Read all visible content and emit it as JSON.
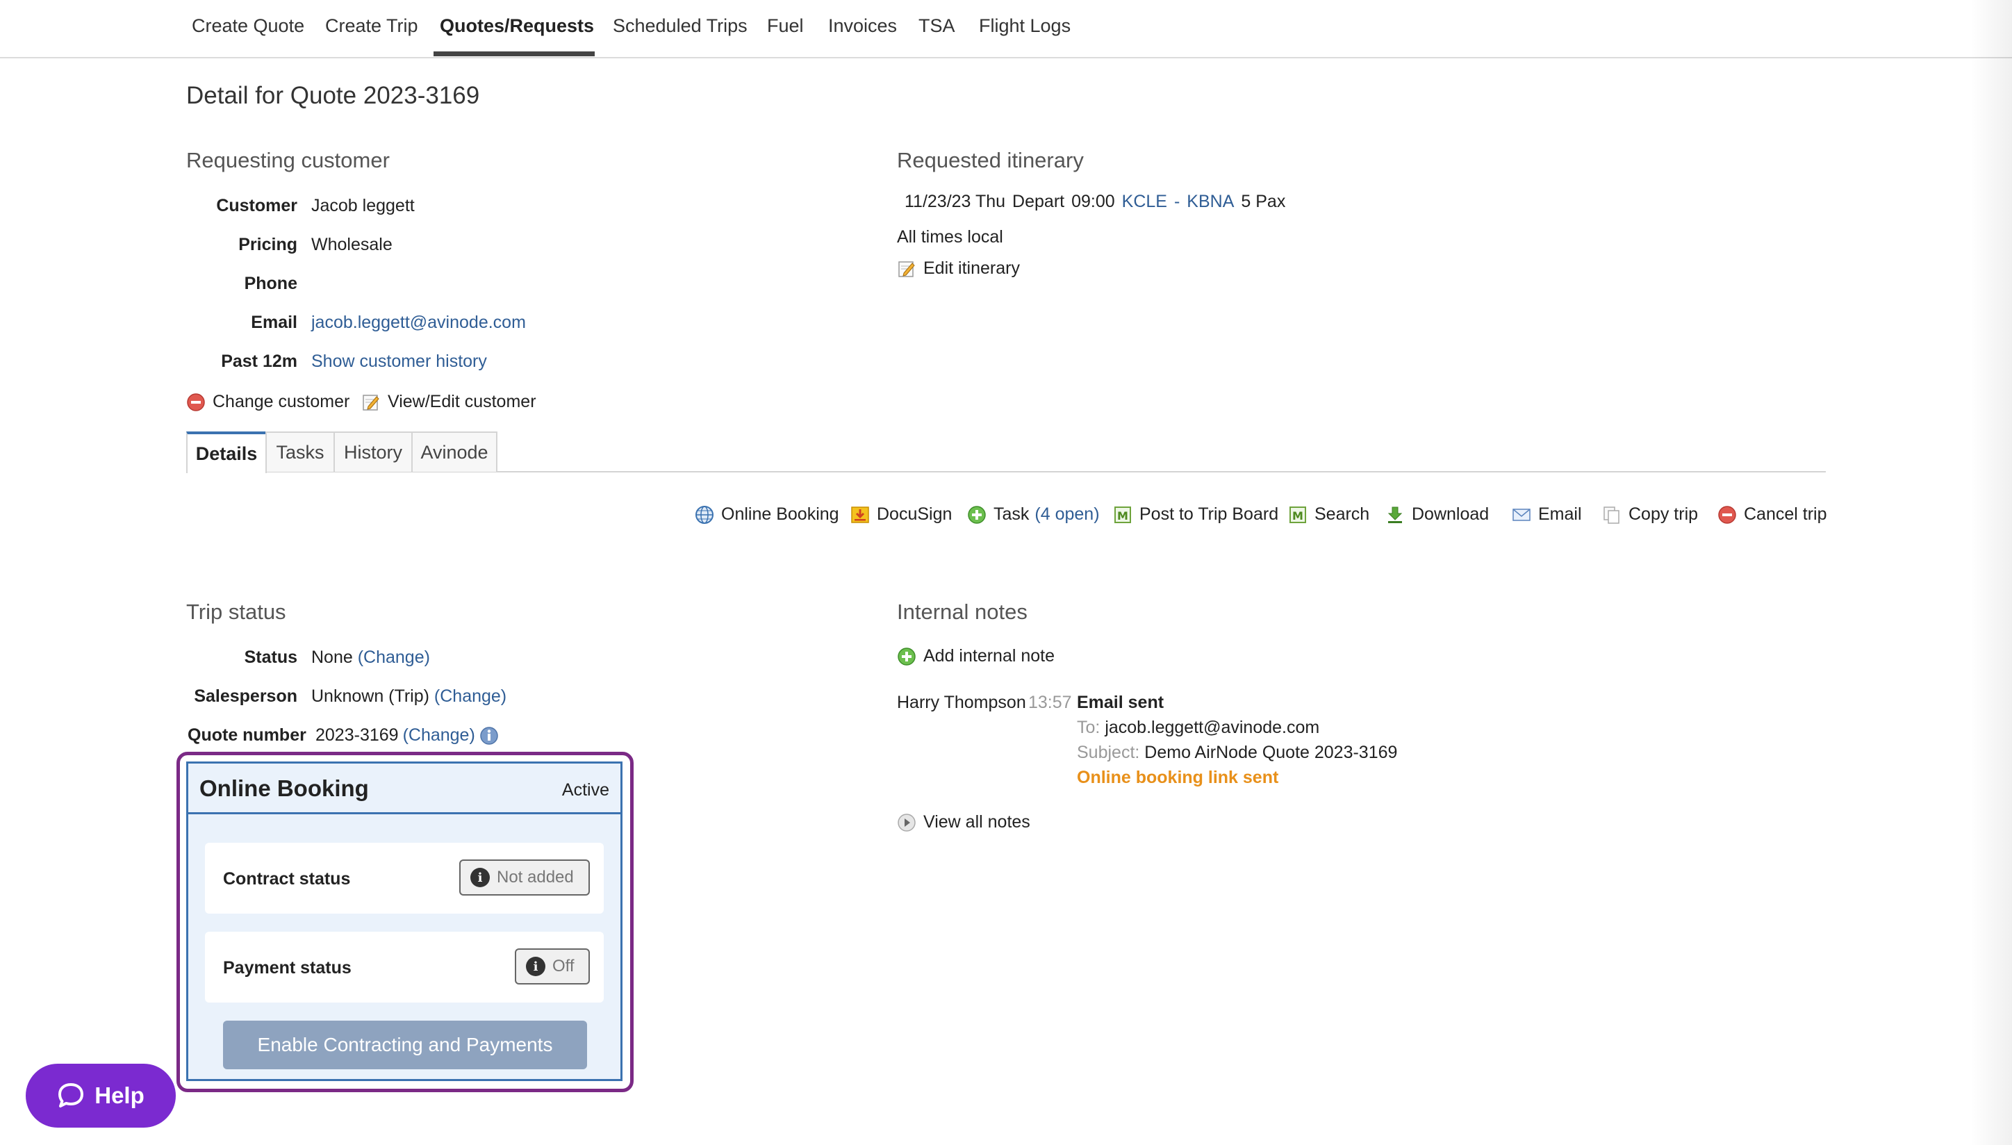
{
  "nav": {
    "items": [
      "Create Quote",
      "Create Trip",
      "Quotes/Requests",
      "Scheduled Trips",
      "Fuel",
      "Invoices",
      "TSA",
      "Flight Logs"
    ],
    "active": "Quotes/Requests"
  },
  "page": {
    "title": "Detail for Quote 2023-3169"
  },
  "customer": {
    "section_title": "Requesting customer",
    "customer_label": "Customer",
    "customer_value": "Jacob leggett",
    "pricing_label": "Pricing",
    "pricing_value": "Wholesale",
    "phone_label": "Phone",
    "phone_value": "",
    "email_label": "Email",
    "email_value": "jacob.leggett@avinode.com",
    "past_label": "Past 12m",
    "past_link": "Show customer history",
    "change_customer": "Change customer",
    "view_edit_customer": "View/Edit customer"
  },
  "itinerary": {
    "section_title": "Requested itinerary",
    "date": "11/23/23 Thu",
    "depart_label": "Depart",
    "time": "09:00",
    "from": "KCLE",
    "separator": "-",
    "to": "KBNA",
    "pax": "5 Pax",
    "note": "All times local",
    "edit": "Edit itinerary"
  },
  "tabs": [
    "Details",
    "Tasks",
    "History",
    "Avinode"
  ],
  "actions": {
    "online_booking": "Online Booking",
    "docusign": "DocuSign",
    "task": "Task",
    "task_open": "(4 open)",
    "post": "Post to Trip Board",
    "search": "Search",
    "download": "Download",
    "email": "Email",
    "copy": "Copy trip",
    "cancel": "Cancel trip"
  },
  "trip_status": {
    "section_title": "Trip status",
    "status_label": "Status",
    "status_value": "None",
    "status_change": "(Change)",
    "sales_label": "Salesperson",
    "sales_value": "Unknown (Trip)",
    "sales_change": "(Change)",
    "quote_label": "Quote number",
    "quote_value": "2023-3169",
    "quote_change": "(Change)"
  },
  "online_booking": {
    "title": "Online Booking",
    "state": "Active",
    "contract_label": "Contract status",
    "contract_value": "Not added",
    "payment_label": "Payment status",
    "payment_value": "Off",
    "enable_button": "Enable Contracting and Payments"
  },
  "notes": {
    "section_title": "Internal notes",
    "add": "Add internal note",
    "entry": {
      "author": "Harry Thompson",
      "time": "13:57",
      "title": "Email sent",
      "to_label": "To:",
      "to_value": "jacob.leggett@avinode.com",
      "subject_label": "Subject:",
      "subject_value": "Demo AirNode Quote 2023-3169",
      "status": "Online booking link sent"
    },
    "view_all": "View all notes"
  },
  "help": {
    "label": "Help"
  },
  "colors": {
    "link": "#2f5d95",
    "accent_purple": "#7b2a86",
    "card_blue": "#3b72b0",
    "note_orange": "#e8901a"
  }
}
